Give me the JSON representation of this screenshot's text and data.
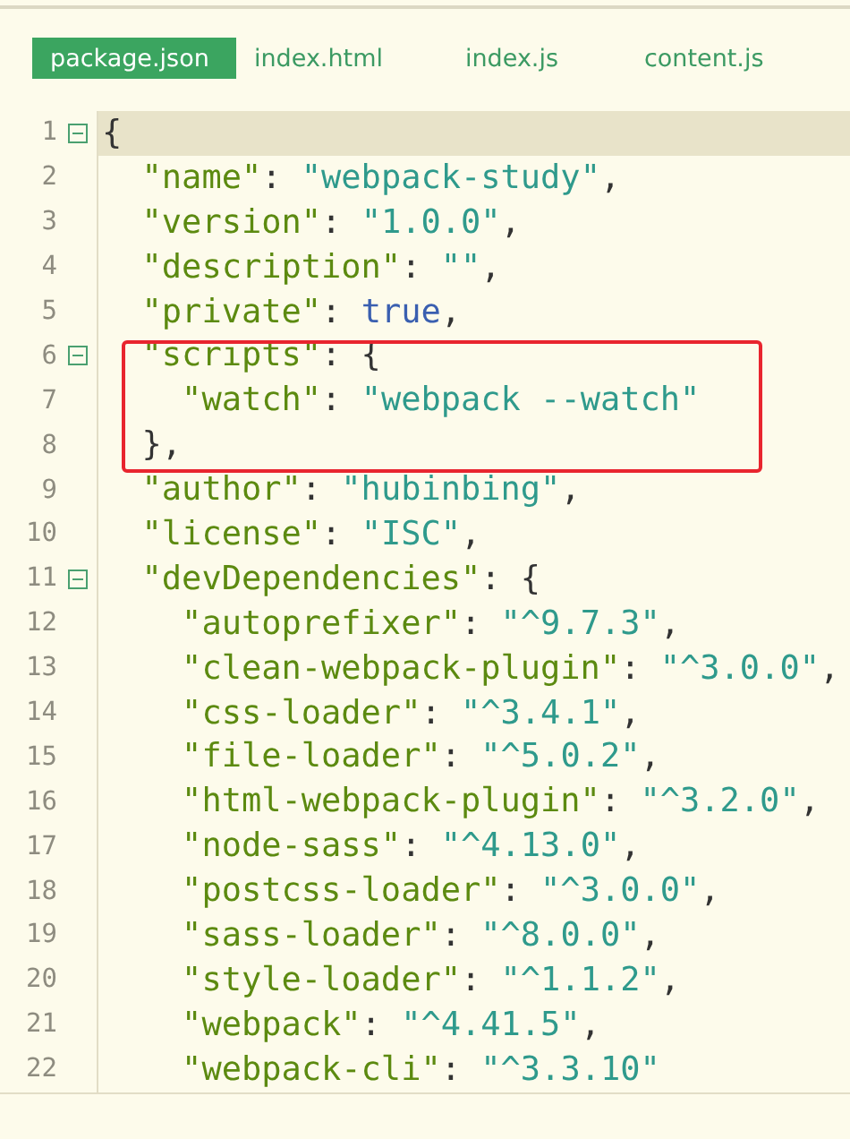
{
  "tabs": [
    {
      "label": "package.json",
      "selected": true
    },
    {
      "label": "index.html",
      "selected": false
    },
    {
      "label": "index.js",
      "selected": false
    },
    {
      "label": "content.js",
      "selected": false
    }
  ],
  "lines": [
    {
      "number": "1",
      "foldable": true,
      "current": true,
      "highlighted": false,
      "tokens": [
        {
          "kind": "punct",
          "text": "{"
        }
      ]
    },
    {
      "number": "2",
      "foldable": false,
      "current": false,
      "highlighted": false,
      "tokens": [
        {
          "kind": "key",
          "text": "  \"name\""
        },
        {
          "kind": "punct",
          "text": ": "
        },
        {
          "kind": "string",
          "text": "\"webpack-study\""
        },
        {
          "kind": "punct",
          "text": ","
        }
      ]
    },
    {
      "number": "3",
      "foldable": false,
      "current": false,
      "highlighted": false,
      "tokens": [
        {
          "kind": "key",
          "text": "  \"version\""
        },
        {
          "kind": "punct",
          "text": ": "
        },
        {
          "kind": "string",
          "text": "\"1.0.0\""
        },
        {
          "kind": "punct",
          "text": ","
        }
      ]
    },
    {
      "number": "4",
      "foldable": false,
      "current": false,
      "highlighted": false,
      "tokens": [
        {
          "kind": "key",
          "text": "  \"description\""
        },
        {
          "kind": "punct",
          "text": ": "
        },
        {
          "kind": "string",
          "text": "\"\""
        },
        {
          "kind": "punct",
          "text": ","
        }
      ]
    },
    {
      "number": "5",
      "foldable": false,
      "current": false,
      "highlighted": false,
      "tokens": [
        {
          "kind": "key",
          "text": "  \"private\""
        },
        {
          "kind": "punct",
          "text": ": "
        },
        {
          "kind": "bool",
          "text": "true"
        },
        {
          "kind": "punct",
          "text": ","
        }
      ]
    },
    {
      "number": "6",
      "foldable": true,
      "current": false,
      "highlighted": true,
      "tokens": [
        {
          "kind": "key",
          "text": "  \"scripts\""
        },
        {
          "kind": "punct",
          "text": ": {"
        }
      ]
    },
    {
      "number": "7",
      "foldable": false,
      "current": false,
      "highlighted": true,
      "tokens": [
        {
          "kind": "key",
          "text": "    \"watch\""
        },
        {
          "kind": "punct",
          "text": ": "
        },
        {
          "kind": "string",
          "text": "\"webpack --watch\""
        }
      ]
    },
    {
      "number": "8",
      "foldable": false,
      "current": false,
      "highlighted": true,
      "tokens": [
        {
          "kind": "punct",
          "text": "  },"
        }
      ]
    },
    {
      "number": "9",
      "foldable": false,
      "current": false,
      "highlighted": false,
      "tokens": [
        {
          "kind": "key",
          "text": "  \"author\""
        },
        {
          "kind": "punct",
          "text": ": "
        },
        {
          "kind": "string",
          "text": "\"hubinbing\""
        },
        {
          "kind": "punct",
          "text": ","
        }
      ]
    },
    {
      "number": "10",
      "foldable": false,
      "current": false,
      "highlighted": false,
      "tokens": [
        {
          "kind": "key",
          "text": "  \"license\""
        },
        {
          "kind": "punct",
          "text": ": "
        },
        {
          "kind": "string",
          "text": "\"ISC\""
        },
        {
          "kind": "punct",
          "text": ","
        }
      ]
    },
    {
      "number": "11",
      "foldable": true,
      "current": false,
      "highlighted": false,
      "tokens": [
        {
          "kind": "key",
          "text": "  \"devDependencies\""
        },
        {
          "kind": "punct",
          "text": ": {"
        }
      ]
    },
    {
      "number": "12",
      "foldable": false,
      "current": false,
      "highlighted": false,
      "tokens": [
        {
          "kind": "key",
          "text": "    \"autoprefixer\""
        },
        {
          "kind": "punct",
          "text": ": "
        },
        {
          "kind": "string",
          "text": "\"^9.7.3\""
        },
        {
          "kind": "punct",
          "text": ","
        }
      ]
    },
    {
      "number": "13",
      "foldable": false,
      "current": false,
      "highlighted": false,
      "tokens": [
        {
          "kind": "key",
          "text": "    \"clean-webpack-plugin\""
        },
        {
          "kind": "punct",
          "text": ": "
        },
        {
          "kind": "string",
          "text": "\"^3.0.0\""
        },
        {
          "kind": "punct",
          "text": ","
        }
      ]
    },
    {
      "number": "14",
      "foldable": false,
      "current": false,
      "highlighted": false,
      "tokens": [
        {
          "kind": "key",
          "text": "    \"css-loader\""
        },
        {
          "kind": "punct",
          "text": ": "
        },
        {
          "kind": "string",
          "text": "\"^3.4.1\""
        },
        {
          "kind": "punct",
          "text": ","
        }
      ]
    },
    {
      "number": "15",
      "foldable": false,
      "current": false,
      "highlighted": false,
      "tokens": [
        {
          "kind": "key",
          "text": "    \"file-loader\""
        },
        {
          "kind": "punct",
          "text": ": "
        },
        {
          "kind": "string",
          "text": "\"^5.0.2\""
        },
        {
          "kind": "punct",
          "text": ","
        }
      ]
    },
    {
      "number": "16",
      "foldable": false,
      "current": false,
      "highlighted": false,
      "tokens": [
        {
          "kind": "key",
          "text": "    \"html-webpack-plugin\""
        },
        {
          "kind": "punct",
          "text": ": "
        },
        {
          "kind": "string",
          "text": "\"^3.2.0\""
        },
        {
          "kind": "punct",
          "text": ","
        }
      ]
    },
    {
      "number": "17",
      "foldable": false,
      "current": false,
      "highlighted": false,
      "tokens": [
        {
          "kind": "key",
          "text": "    \"node-sass\""
        },
        {
          "kind": "punct",
          "text": ": "
        },
        {
          "kind": "string",
          "text": "\"^4.13.0\""
        },
        {
          "kind": "punct",
          "text": ","
        }
      ]
    },
    {
      "number": "18",
      "foldable": false,
      "current": false,
      "highlighted": false,
      "tokens": [
        {
          "kind": "key",
          "text": "    \"postcss-loader\""
        },
        {
          "kind": "punct",
          "text": ": "
        },
        {
          "kind": "string",
          "text": "\"^3.0.0\""
        },
        {
          "kind": "punct",
          "text": ","
        }
      ]
    },
    {
      "number": "19",
      "foldable": false,
      "current": false,
      "highlighted": false,
      "tokens": [
        {
          "kind": "key",
          "text": "    \"sass-loader\""
        },
        {
          "kind": "punct",
          "text": ": "
        },
        {
          "kind": "string",
          "text": "\"^8.0.0\""
        },
        {
          "kind": "punct",
          "text": ","
        }
      ]
    },
    {
      "number": "20",
      "foldable": false,
      "current": false,
      "highlighted": false,
      "tokens": [
        {
          "kind": "key",
          "text": "    \"style-loader\""
        },
        {
          "kind": "punct",
          "text": ": "
        },
        {
          "kind": "string",
          "text": "\"^1.1.2\""
        },
        {
          "kind": "punct",
          "text": ","
        }
      ]
    },
    {
      "number": "21",
      "foldable": false,
      "current": false,
      "highlighted": false,
      "tokens": [
        {
          "kind": "key",
          "text": "    \"webpack\""
        },
        {
          "kind": "punct",
          "text": ": "
        },
        {
          "kind": "string",
          "text": "\"^4.41.5\""
        },
        {
          "kind": "punct",
          "text": ","
        }
      ]
    },
    {
      "number": "22",
      "foldable": false,
      "current": false,
      "highlighted": false,
      "tokens": [
        {
          "kind": "key",
          "text": "    \"webpack-cli\""
        },
        {
          "kind": "punct",
          "text": ": "
        },
        {
          "kind": "string",
          "text": "\"^3.3.10\""
        }
      ]
    }
  ]
}
